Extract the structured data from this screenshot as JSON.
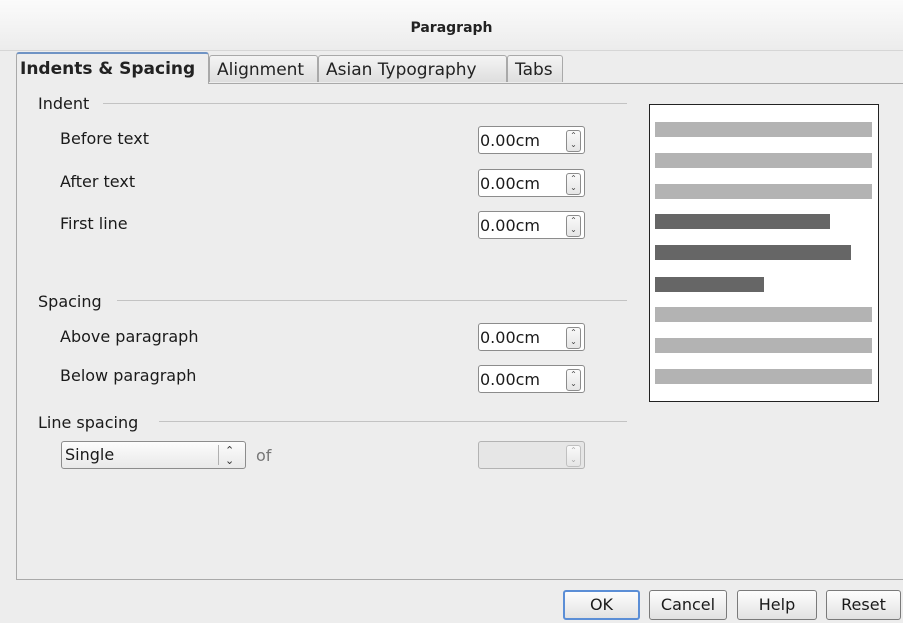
{
  "window": {
    "title": "Paragraph"
  },
  "tabs": [
    "Indents & Spacing",
    "Alignment",
    "Asian Typography",
    "Tabs"
  ],
  "indent": {
    "heading": "Indent",
    "before_text": {
      "label": "Before text",
      "value": "0.00cm"
    },
    "after_text": {
      "label": "After text",
      "value": "0.00cm"
    },
    "first_line": {
      "label": "First line",
      "value": "0.00cm"
    }
  },
  "spacing": {
    "heading": "Spacing",
    "above": {
      "label": "Above paragraph",
      "value": "0.00cm"
    },
    "below": {
      "label": "Below paragraph",
      "value": "0.00cm"
    }
  },
  "line_spacing": {
    "heading": "Line spacing",
    "selected": "Single",
    "of_label": "of",
    "of_value": ""
  },
  "buttons": {
    "ok": "OK",
    "cancel": "Cancel",
    "help": "Help",
    "reset": "Reset"
  },
  "colors": {
    "preview_light": "#b3b3b3",
    "preview_dark": "#666666",
    "tab_accent": "#6f93c4",
    "default_button_border": "#5b8ed6"
  },
  "icons": {
    "spin": "up-down-spin-icon",
    "select": "chevron-up-down-icon"
  }
}
